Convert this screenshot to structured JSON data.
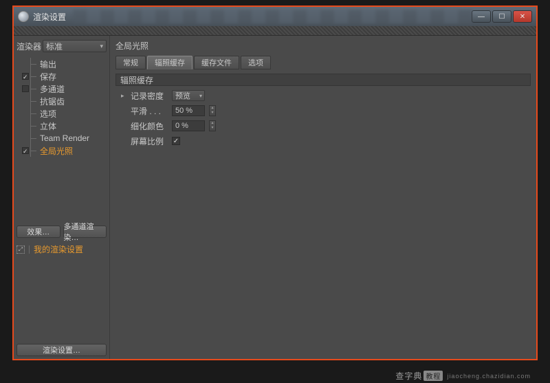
{
  "window": {
    "title": "渲染设置"
  },
  "sidebar": {
    "renderer_label": "渲染器",
    "renderer_value": "标准",
    "items": [
      {
        "label": "输出",
        "checked": null
      },
      {
        "label": "保存",
        "checked": true
      },
      {
        "label": "多通道",
        "checked": false
      },
      {
        "label": "抗锯齿",
        "checked": null
      },
      {
        "label": "选项",
        "checked": null
      },
      {
        "label": "立体",
        "checked": null
      },
      {
        "label": "Team Render",
        "checked": null
      },
      {
        "label": "全局光照",
        "checked": true,
        "active": true
      }
    ],
    "effects_button": "效果…",
    "multipass_button": "多通道渲染…",
    "my_settings_label": "我的渲染设置",
    "footer_button": "渲染设置…"
  },
  "main": {
    "title": "全局光照",
    "tabs": [
      {
        "label": "常规",
        "active": false
      },
      {
        "label": "辐照缓存",
        "active": true
      },
      {
        "label": "缓存文件",
        "active": false
      },
      {
        "label": "选项",
        "active": false
      }
    ],
    "group_header": "辐照缓存",
    "params": {
      "record_density": {
        "label": "记录密度",
        "value": "预览"
      },
      "smoothing": {
        "label": "平滑 . . .",
        "value": "50 %"
      },
      "detail_color": {
        "label": "细化颜色",
        "value": "0 %"
      },
      "screen_scale": {
        "label": "屏幕比例",
        "checked": true
      }
    }
  },
  "watermark": {
    "text": "查字典",
    "sub": "教程",
    "url": "jiaocheng.chazidian.com"
  }
}
